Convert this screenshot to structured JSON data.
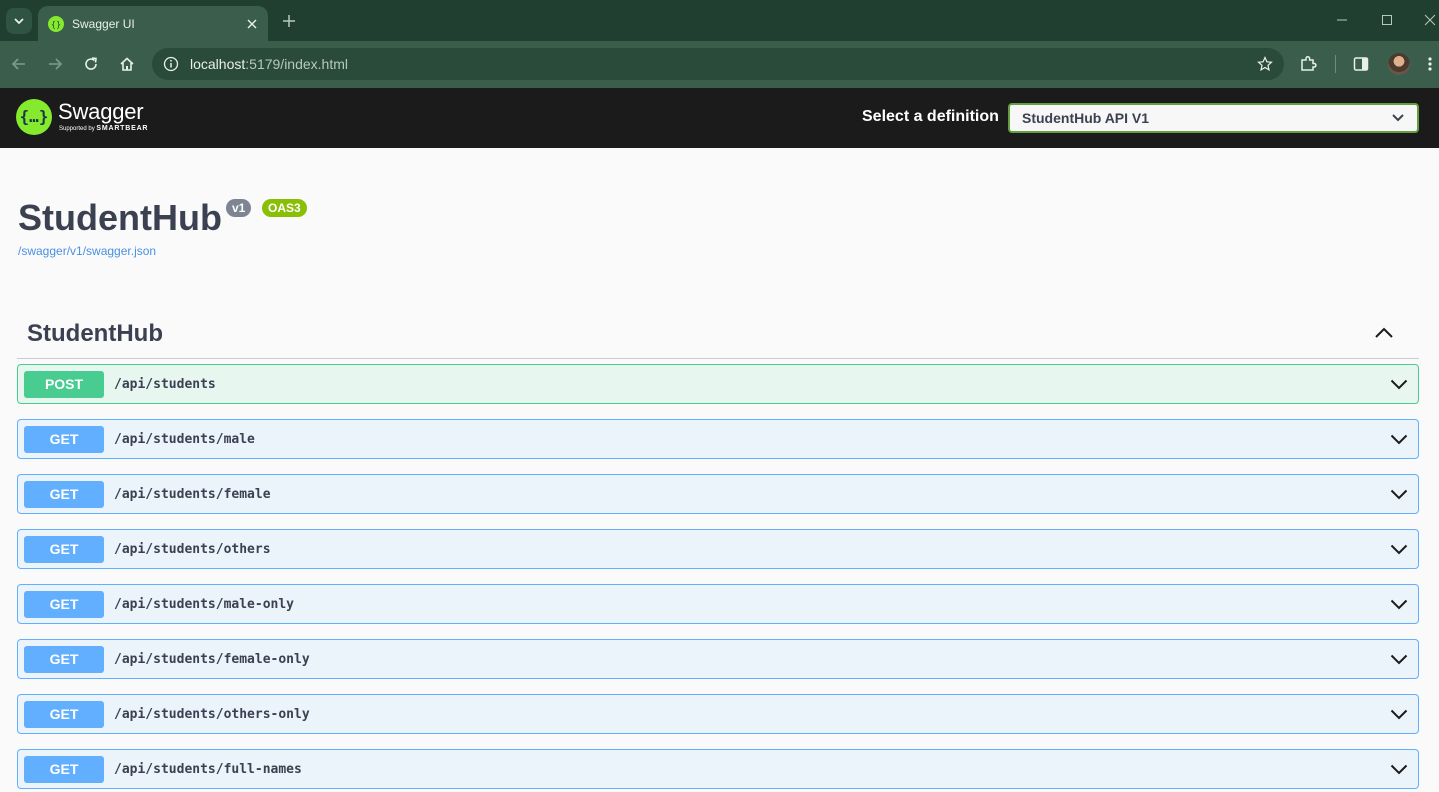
{
  "browser": {
    "tab_title": "Swagger UI",
    "url_host": "localhost",
    "url_path": ":5179/index.html"
  },
  "topbar": {
    "logo_word": "Swagger",
    "logo_sub_prefix": "Supported by ",
    "logo_sub_brand": "SMARTBEAR",
    "definition_label": "Select a definition",
    "definition_value": "StudentHub API V1"
  },
  "info": {
    "title": "StudentHub",
    "version_badge": "v1",
    "oas_badge": "OAS3",
    "spec_link": "/swagger/v1/swagger.json"
  },
  "tag": {
    "name": "StudentHub"
  },
  "operations": [
    {
      "method": "POST",
      "path": "/api/students"
    },
    {
      "method": "GET",
      "path": "/api/students/male"
    },
    {
      "method": "GET",
      "path": "/api/students/female"
    },
    {
      "method": "GET",
      "path": "/api/students/others"
    },
    {
      "method": "GET",
      "path": "/api/students/male-only"
    },
    {
      "method": "GET",
      "path": "/api/students/female-only"
    },
    {
      "method": "GET",
      "path": "/api/students/others-only"
    },
    {
      "method": "GET",
      "path": "/api/students/full-names"
    }
  ],
  "colors": {
    "post": "#49cc90",
    "get": "#61affe",
    "swagger_green": "#85ea2d",
    "oas_badge": "#89bf04"
  }
}
